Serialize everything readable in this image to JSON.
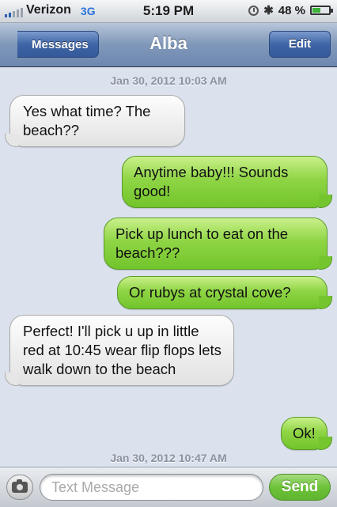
{
  "status_bar": {
    "carrier": "Verizon",
    "network": "3G",
    "time": "5:19 PM",
    "battery_label": "48 %",
    "battery_level": 0.48,
    "icons": [
      "signal-icon",
      "orientation-lock-icon",
      "bluetooth-icon",
      "battery-icon"
    ]
  },
  "nav": {
    "back_label": "Messages",
    "title": "Alba",
    "edit_label": "Edit"
  },
  "conversation": {
    "timestamps": [
      "Jan 30, 2012 10:03 AM",
      "Jan 30, 2012 10:47 AM"
    ],
    "messages": [
      {
        "direction": "in",
        "text": "Yes what time? The beach??"
      },
      {
        "direction": "out",
        "text": "Anytime baby!!! Sounds good!"
      },
      {
        "direction": "out",
        "text": "Pick up lunch to eat on the beach???"
      },
      {
        "direction": "out",
        "text": "Or rubys at crystal cove?"
      },
      {
        "direction": "in",
        "text": "Perfect! I'll pick u up in little red at 10:45 wear flip flops lets walk down to the beach"
      },
      {
        "direction": "out",
        "text": "Ok!"
      }
    ]
  },
  "input_bar": {
    "placeholder": "Text Message",
    "value": "",
    "send_label": "Send"
  },
  "colors": {
    "outgoing_bubble": "#8fd545",
    "incoming_bubble": "#eeeeee",
    "nav_bar": "#7f97b9",
    "background": "#dbe2ed"
  }
}
